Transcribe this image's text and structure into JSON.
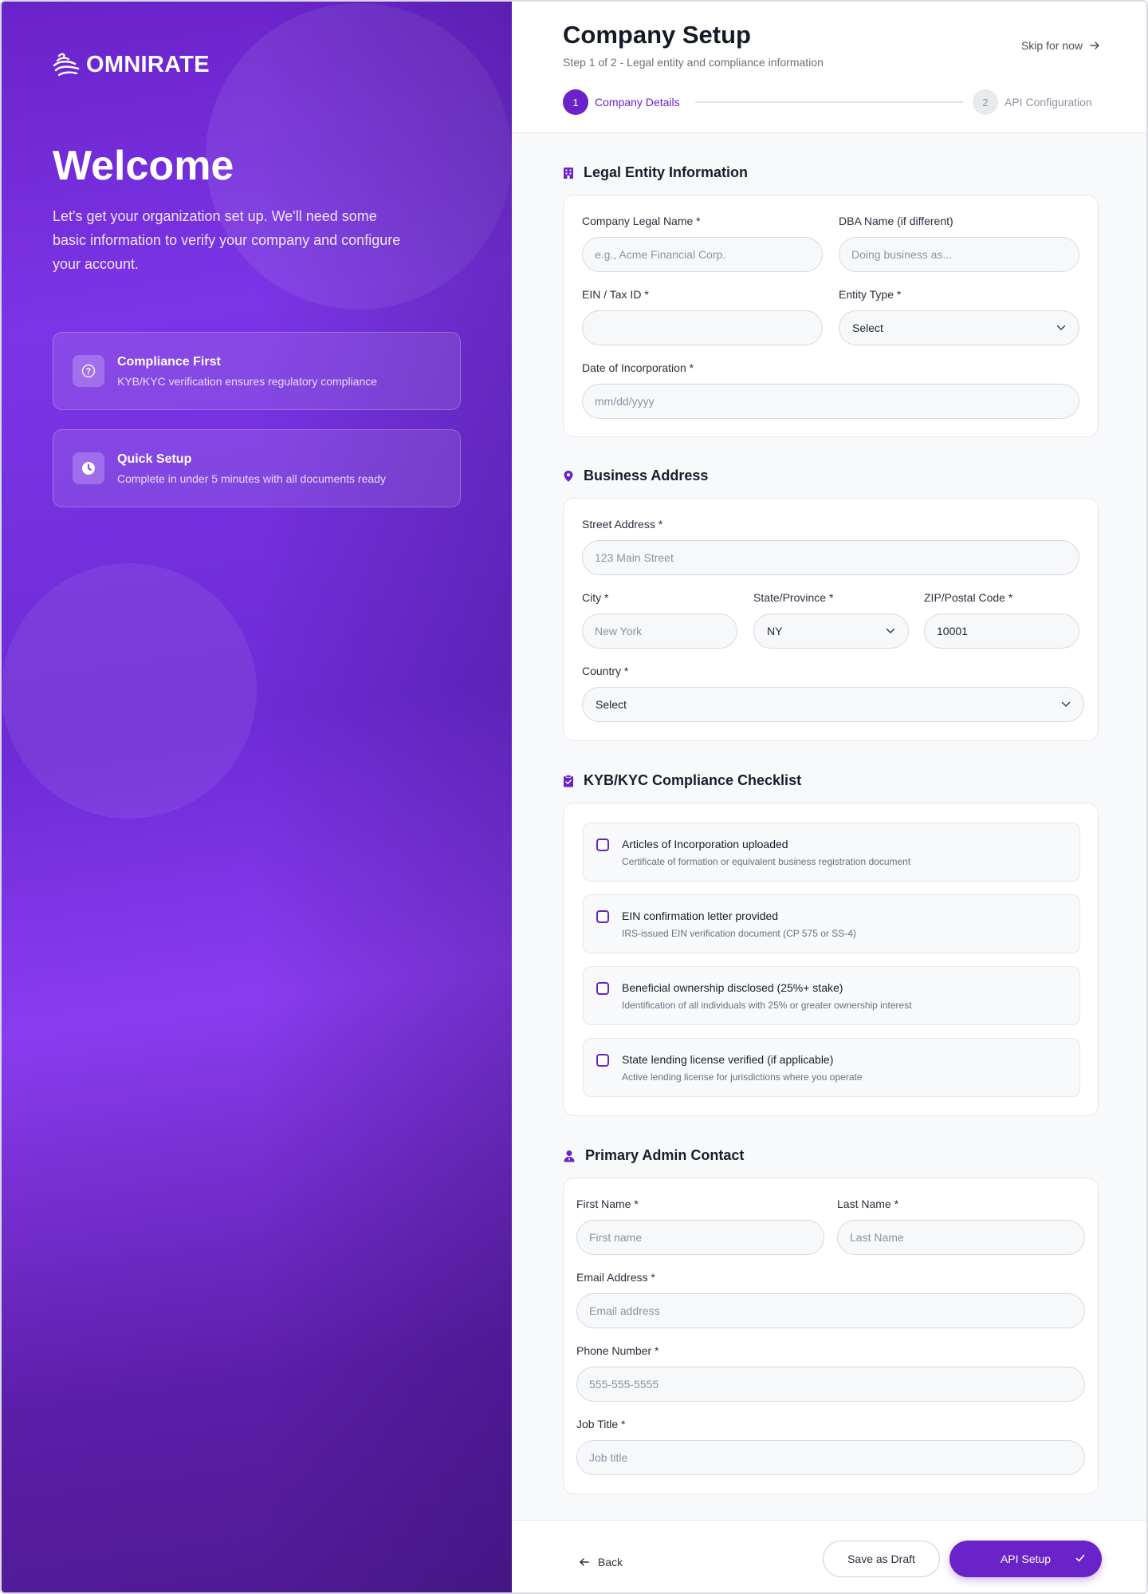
{
  "brand": {
    "name": "OMNIRATE"
  },
  "left": {
    "welcome": "Welcome",
    "intro": "Let's get your organization set up. We'll need some basic information to verify your company and configure your account.",
    "features": [
      {
        "title": "Compliance First",
        "desc": "KYB/KYC verification ensures regulatory compliance",
        "icon": "question-shield-icon"
      },
      {
        "title": "Quick Setup",
        "desc": "Complete in under 5 minutes with all documents ready",
        "icon": "clock-icon"
      }
    ]
  },
  "header": {
    "title": "Company Setup",
    "subtitle": "Step 1 of 2 - Legal entity and compliance information",
    "skip": "Skip for now",
    "steps": [
      {
        "number": "1",
        "label": "Company Details",
        "state": "active"
      },
      {
        "number": "2",
        "label": "API Configuration",
        "state": "inactive"
      }
    ]
  },
  "legal": {
    "title": "Legal Entity Information",
    "company_label": "Company Legal Name *",
    "company_placeholder": "e.g., Acme Financial Corp.",
    "dba_label": "DBA Name (if different)",
    "dba_placeholder": "Doing business as...",
    "ein_label": "EIN / Tax ID *",
    "ein_placeholder": "",
    "entity_label": "Entity Type *",
    "entity_value": "Select",
    "doi_label": "Date of Incorporation *",
    "doi_placeholder": "mm/dd/yyyy"
  },
  "address": {
    "title": "Business Address",
    "street_label": "Street Address *",
    "street_placeholder": "123 Main Street",
    "city_label": "City *",
    "city_placeholder": "New York",
    "state_label": "State/Province *",
    "state_value": "NY",
    "zip_label": "ZIP/Postal Code *",
    "zip_value": "10001",
    "country_label": "Country *",
    "country_value": "Select"
  },
  "compliance": {
    "title": "KYB/KYC Compliance Checklist",
    "items": [
      {
        "title": "Articles of Incorporation uploaded",
        "desc": "Certificate of formation or equivalent business registration document",
        "checked": false
      },
      {
        "title": "EIN confirmation letter provided",
        "desc": "IRS-issued EIN verification document (CP 575 or SS-4)",
        "checked": false
      },
      {
        "title": "Beneficial ownership disclosed (25%+ stake)",
        "desc": "Identification of all individuals with 25% or greater ownership interest",
        "checked": false
      },
      {
        "title": "State lending license verified (if applicable)",
        "desc": "Active lending license for jurisdictions where you operate",
        "checked": false
      }
    ]
  },
  "admin": {
    "title": "Primary Admin Contact",
    "first_label": "First Name *",
    "first_placeholder": "First name",
    "last_label": "Last Name *",
    "last_placeholder": "Last Name",
    "email_label": "Email Address *",
    "email_placeholder": "Email address",
    "phone_label": "Phone Number *",
    "phone_placeholder": "555-555-5555",
    "job_label": "Job Title *",
    "job_placeholder": "Job title"
  },
  "footer": {
    "back": "Back",
    "draft": "Save as Draft",
    "next": "API Setup"
  },
  "colors": {
    "accent": "#6a22c9",
    "accent_light": "#8a3cf0"
  }
}
